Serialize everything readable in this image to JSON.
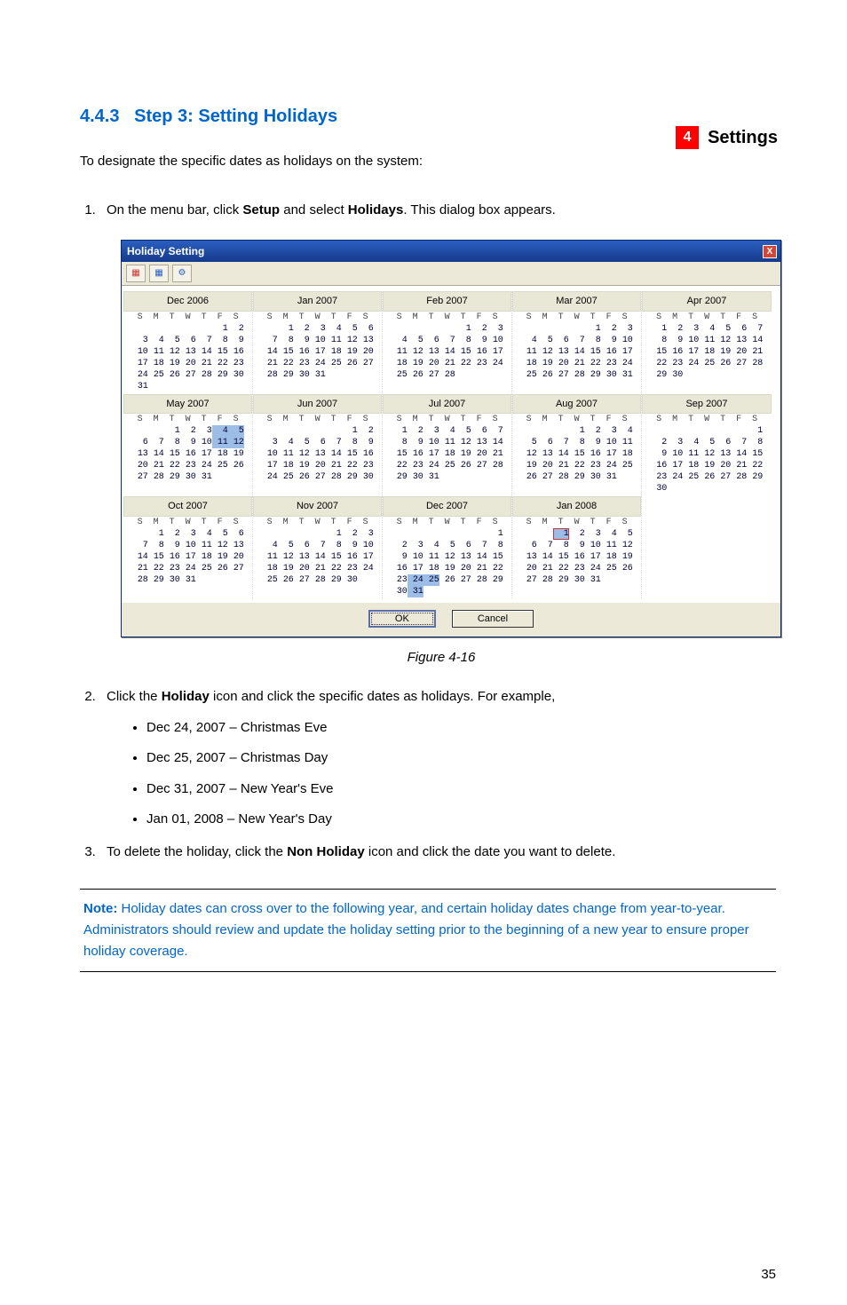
{
  "header": {
    "chapter_num": "4",
    "chapter_title": "Settings"
  },
  "section": {
    "number": "4.4.3",
    "title": "Step 3: Setting Holidays"
  },
  "intro": "To designate the specific dates as holidays on the system:",
  "steps": {
    "one_pre": "On the menu bar, click ",
    "one_setup": "Setup",
    "one_mid": " and select ",
    "one_hol": "Holidays",
    "one_post": ". This dialog box appears.",
    "two_pre": "Click the ",
    "two_hol": "Holiday",
    "two_post": " icon and click the specific dates as holidays. For example,",
    "three_pre": "To delete the holiday, click the ",
    "three_non": "Non Holiday",
    "three_post": " icon and click the date you want to delete."
  },
  "example_dates": [
    "Dec 24, 2007 – Christmas Eve",
    "Dec 25, 2007 – Christmas Day",
    "Dec 31, 2007 – New Year's Eve",
    "Jan 01, 2008 – New Year's Day"
  ],
  "figure_caption": "Figure 4-16",
  "note": {
    "label": "Note:",
    "text": " Holiday dates can cross over to the following year, and certain holiday dates change from year-to-year. Administrators should review and update the holiday setting prior to the beginning of a new year to ensure proper holiday coverage."
  },
  "page_number": "35",
  "dialog": {
    "title": "Holiday Setting",
    "ok": "OK",
    "cancel": "Cancel",
    "months": [
      {
        "name": "Dec 2006",
        "start": 5,
        "days": 31
      },
      {
        "name": "Jan 2007",
        "start": 1,
        "days": 31
      },
      {
        "name": "Feb 2007",
        "start": 4,
        "days": 28
      },
      {
        "name": "Mar 2007",
        "start": 4,
        "days": 31
      },
      {
        "name": "Apr 2007",
        "start": 0,
        "days": 30
      },
      {
        "name": "May 2007",
        "start": 2,
        "days": 31,
        "hl": [
          4,
          5,
          11,
          12
        ]
      },
      {
        "name": "Jun 2007",
        "start": 5,
        "days": 30
      },
      {
        "name": "Jul 2007",
        "start": 0,
        "days": 31
      },
      {
        "name": "Aug 2007",
        "start": 3,
        "days": 31
      },
      {
        "name": "Sep 2007",
        "start": 6,
        "days": 30
      },
      {
        "name": "Oct 2007",
        "start": 1,
        "days": 31
      },
      {
        "name": "Nov 2007",
        "start": 4,
        "days": 30
      },
      {
        "name": "Dec 2007",
        "start": 6,
        "days": 31,
        "hl": [
          24,
          25,
          31
        ]
      },
      {
        "name": "Jan 2008",
        "start": 2,
        "days": 31,
        "hl": [
          1
        ],
        "today": 1
      }
    ],
    "dow": [
      "S",
      "M",
      "T",
      "W",
      "T",
      "F",
      "S"
    ]
  }
}
